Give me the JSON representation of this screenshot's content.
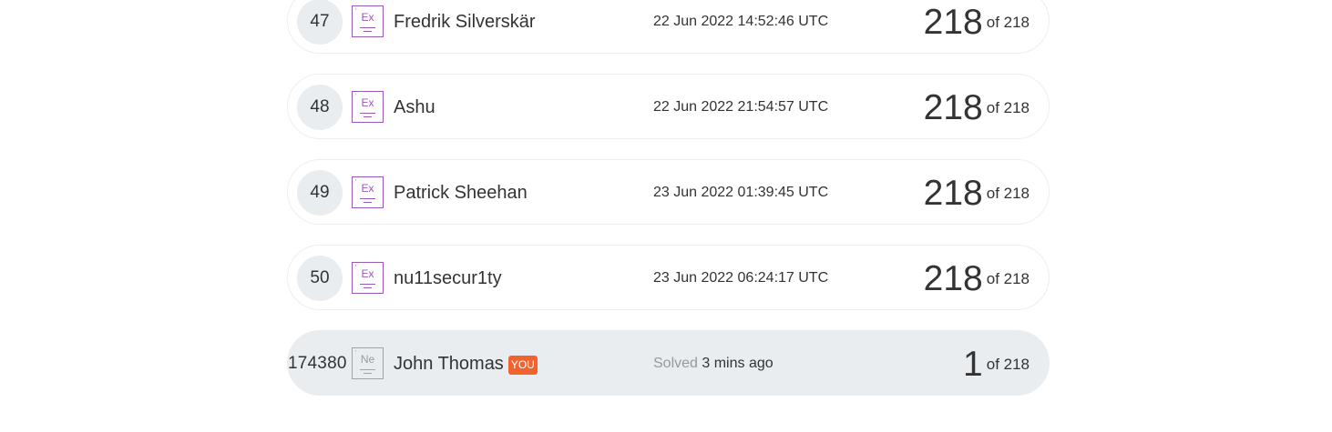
{
  "leaderboard": {
    "rows": [
      {
        "rank": "47",
        "badge_symbol": "Ex",
        "name": "Fredrik Silverskär",
        "timestamp": "22 Jun 2022 14:52:46 UTC",
        "score": "218",
        "of_label": "of 218"
      },
      {
        "rank": "48",
        "badge_symbol": "Ex",
        "name": "Ashu",
        "timestamp": "22 Jun 2022 21:54:57 UTC",
        "score": "218",
        "of_label": "of 218"
      },
      {
        "rank": "49",
        "badge_symbol": "Ex",
        "name": "Patrick Sheehan",
        "timestamp": "23 Jun 2022 01:39:45 UTC",
        "score": "218",
        "of_label": "of 218"
      },
      {
        "rank": "50",
        "badge_symbol": "Ex",
        "name": "nu11secur1ty",
        "timestamp": "23 Jun 2022 06:24:17 UTC",
        "score": "218",
        "of_label": "of 218"
      }
    ],
    "current_user": {
      "rank": "174380",
      "badge_symbol": "Ne",
      "name": "John Thomas",
      "you_badge": "YOU",
      "solved_label": "Solved",
      "solved_ago": "3 mins ago",
      "score": "1",
      "of_label": "of 218"
    }
  },
  "colors": {
    "badge_expert": "#9b59b6",
    "badge_newbie": "#a3a3a3",
    "you_badge": "#f0632e",
    "highlight_row": "#e9edf0"
  }
}
